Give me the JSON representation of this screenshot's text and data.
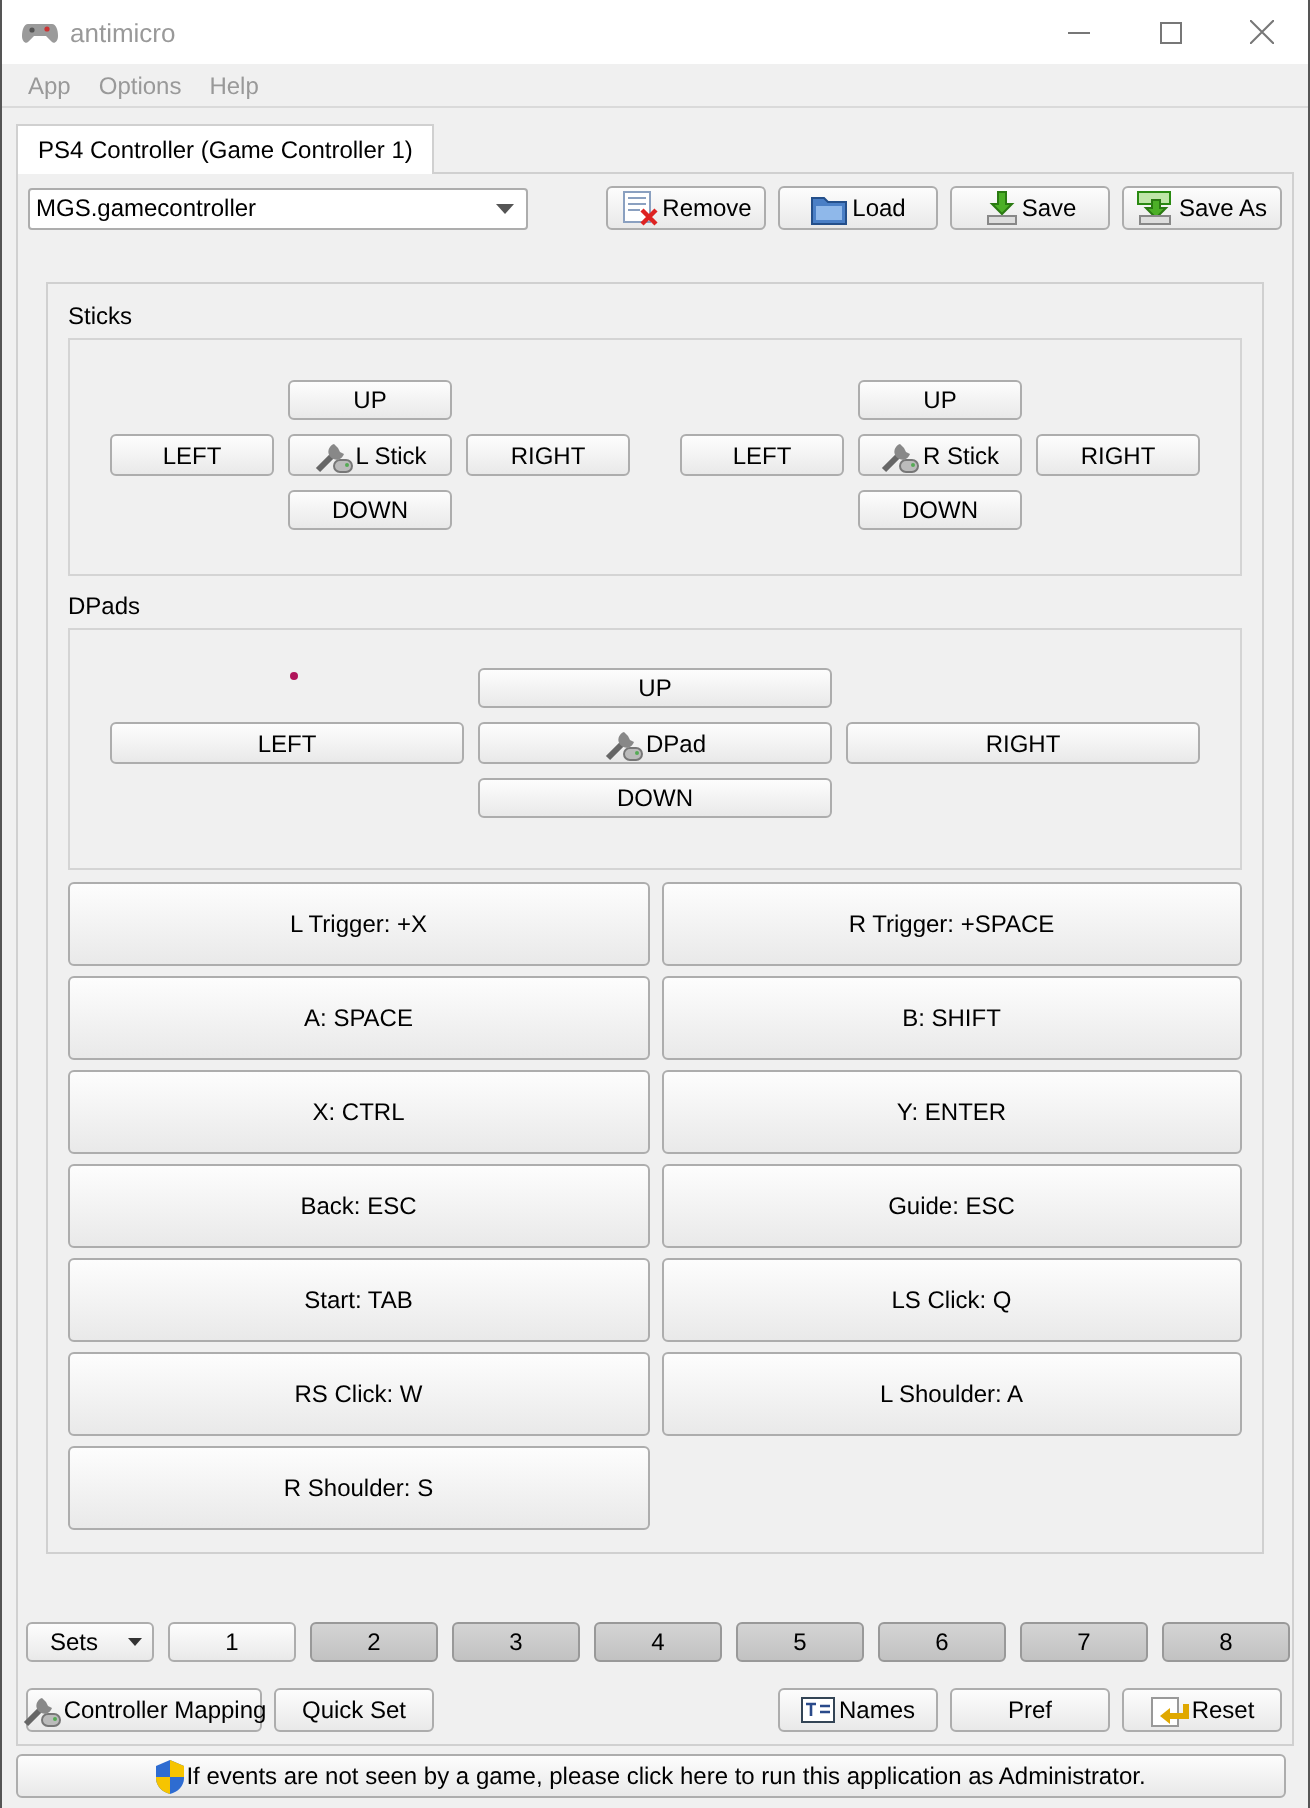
{
  "window": {
    "title": "antimicro"
  },
  "menu": [
    {
      "label": "App"
    },
    {
      "label": "Options"
    },
    {
      "label": "Help"
    }
  ],
  "tabs": [
    {
      "label": "PS4 Controller (Game Controller 1)",
      "selected": true
    }
  ],
  "profile": {
    "value": "MGS.gamecontroller"
  },
  "toolbar": [
    {
      "label": "Remove",
      "kind": "remove"
    },
    {
      "label": "Load",
      "kind": "load"
    },
    {
      "label": "Save",
      "kind": "save"
    },
    {
      "label": "Save As",
      "kind": "saveas"
    }
  ],
  "sticks": {
    "title": "Sticks",
    "items": [
      {
        "up": "UP",
        "left": "LEFT",
        "center": "L Stick",
        "right": "RIGHT",
        "down": "DOWN"
      },
      {
        "up": "UP",
        "left": "LEFT",
        "center": "R Stick",
        "right": "RIGHT",
        "down": "DOWN"
      }
    ]
  },
  "dpads": {
    "title": "DPads",
    "items": [
      {
        "up": "UP",
        "left": "LEFT",
        "center": "DPad",
        "right": "RIGHT",
        "down": "DOWN"
      }
    ]
  },
  "buttons": [
    "L Trigger: +X",
    "R Trigger: +SPACE",
    "A: SPACE",
    "B: SHIFT",
    "X: CTRL",
    "Y: ENTER",
    "Back: ESC",
    "Guide: ESC",
    "Start: TAB",
    "LS Click: Q",
    "RS Click: W",
    "L Shoulder: A",
    "R Shoulder: S"
  ],
  "sets": {
    "label": "Sets",
    "items": [
      {
        "label": "1",
        "selected": true
      },
      {
        "label": "2",
        "selected": false
      },
      {
        "label": "3",
        "selected": false
      },
      {
        "label": "4",
        "selected": false
      },
      {
        "label": "5",
        "selected": false
      },
      {
        "label": "6",
        "selected": false
      },
      {
        "label": "7",
        "selected": false
      },
      {
        "label": "8",
        "selected": false
      }
    ]
  },
  "bottom_left": [
    {
      "label": "Controller Mapping",
      "kind": "mapping"
    },
    {
      "label": "Quick Set",
      "kind": "plain"
    }
  ],
  "bottom_right": [
    {
      "label": "Names",
      "kind": "names"
    },
    {
      "label": "Pref",
      "kind": "plain"
    },
    {
      "label": "Reset",
      "kind": "reset"
    }
  ],
  "status_bar": {
    "text": "If events are not seen by a game, please click here to run this application as Administrator."
  }
}
